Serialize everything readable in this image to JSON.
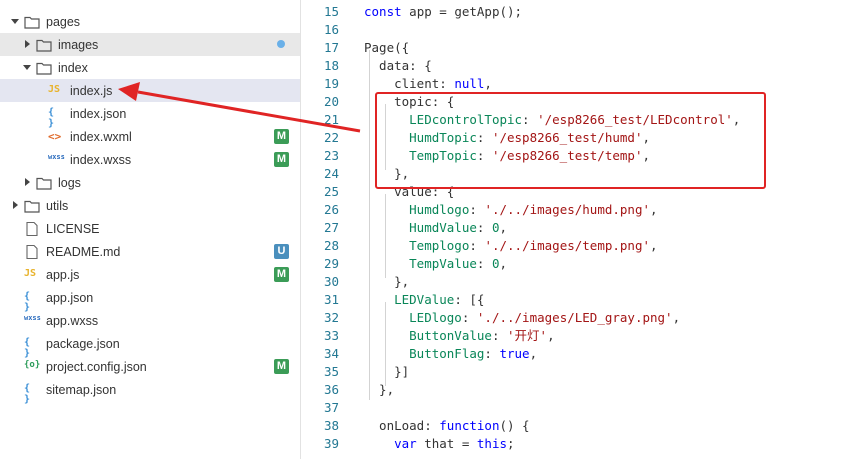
{
  "explorer": {
    "items": [
      {
        "label": "pages",
        "type": "folder",
        "expanded": true,
        "depth": 0
      },
      {
        "label": "images",
        "type": "folder",
        "expanded": false,
        "depth": 1,
        "dot": true
      },
      {
        "label": "index",
        "type": "folder",
        "expanded": true,
        "depth": 1
      },
      {
        "label": "index.js",
        "type": "js",
        "depth": 2,
        "selected": true
      },
      {
        "label": "index.json",
        "type": "json",
        "depth": 2
      },
      {
        "label": "index.wxml",
        "type": "wxml",
        "depth": 2,
        "badge": "M"
      },
      {
        "label": "index.wxss",
        "type": "wxss",
        "depth": 2,
        "badge": "M"
      },
      {
        "label": "logs",
        "type": "folder",
        "expanded": false,
        "depth": 1
      },
      {
        "label": "utils",
        "type": "folder",
        "expanded": false,
        "depth": 0
      },
      {
        "label": "LICENSE",
        "type": "file",
        "depth": 0
      },
      {
        "label": "README.md",
        "type": "file",
        "depth": 0,
        "badge": "U"
      },
      {
        "label": "app.js",
        "type": "js",
        "depth": 0,
        "badge": "M"
      },
      {
        "label": "app.json",
        "type": "json",
        "depth": 0
      },
      {
        "label": "app.wxss",
        "type": "wxss",
        "depth": 0
      },
      {
        "label": "package.json",
        "type": "json",
        "depth": 0
      },
      {
        "label": "project.config.json",
        "type": "config",
        "depth": 0,
        "badge": "M"
      },
      {
        "label": "sitemap.json",
        "type": "json",
        "depth": 0
      }
    ],
    "icon_text": {
      "js": "JS",
      "json": "{ }",
      "wxml": "<>",
      "wxss": "wxss",
      "config": "{o}"
    }
  },
  "editor": {
    "lines": [
      {
        "n": "15",
        "tokens": [
          [
            "kw",
            "const"
          ],
          [
            "t",
            " app = getApp();"
          ]
        ]
      },
      {
        "n": "16",
        "tokens": []
      },
      {
        "n": "17",
        "tokens": [
          [
            "t",
            "Page({"
          ]
        ]
      },
      {
        "n": "18",
        "tokens": [
          [
            "t",
            "  data: {"
          ]
        ]
      },
      {
        "n": "19",
        "tokens": [
          [
            "t",
            "    client: "
          ],
          [
            "kw",
            "null"
          ],
          [
            "t",
            ","
          ]
        ]
      },
      {
        "n": "20",
        "tokens": [
          [
            "t",
            "    topic: {"
          ]
        ]
      },
      {
        "n": "21",
        "tokens": [
          [
            "t",
            "      "
          ],
          [
            "prop",
            "LEDcontrolTopic"
          ],
          [
            "t",
            ": "
          ],
          [
            "str",
            "'/esp8266_test/LEDcontrol'"
          ],
          [
            "t",
            ","
          ]
        ]
      },
      {
        "n": "22",
        "tokens": [
          [
            "t",
            "      "
          ],
          [
            "prop",
            "HumdTopic"
          ],
          [
            "t",
            ": "
          ],
          [
            "str",
            "'/esp8266_test/humd'"
          ],
          [
            "t",
            ","
          ]
        ]
      },
      {
        "n": "23",
        "tokens": [
          [
            "t",
            "      "
          ],
          [
            "prop",
            "TempTopic"
          ],
          [
            "t",
            ": "
          ],
          [
            "str",
            "'/esp8266_test/temp'"
          ],
          [
            "t",
            ","
          ]
        ]
      },
      {
        "n": "24",
        "tokens": [
          [
            "t",
            "    },"
          ]
        ]
      },
      {
        "n": "25",
        "tokens": [
          [
            "t",
            "    value: {"
          ]
        ]
      },
      {
        "n": "26",
        "tokens": [
          [
            "t",
            "      "
          ],
          [
            "prop",
            "Humdlogo"
          ],
          [
            "t",
            ": "
          ],
          [
            "str",
            "'./../images/humd.png'"
          ],
          [
            "t",
            ","
          ]
        ]
      },
      {
        "n": "27",
        "tokens": [
          [
            "t",
            "      "
          ],
          [
            "prop",
            "HumdValue"
          ],
          [
            "t",
            ": "
          ],
          [
            "num",
            "0"
          ],
          [
            "t",
            ","
          ]
        ]
      },
      {
        "n": "28",
        "tokens": [
          [
            "t",
            "      "
          ],
          [
            "prop",
            "Templogo"
          ],
          [
            "t",
            ": "
          ],
          [
            "str",
            "'./../images/temp.png'"
          ],
          [
            "t",
            ","
          ]
        ]
      },
      {
        "n": "29",
        "tokens": [
          [
            "t",
            "      "
          ],
          [
            "prop",
            "TempValue"
          ],
          [
            "t",
            ": "
          ],
          [
            "num",
            "0"
          ],
          [
            "t",
            ","
          ]
        ]
      },
      {
        "n": "30",
        "tokens": [
          [
            "t",
            "    },"
          ]
        ]
      },
      {
        "n": "31",
        "tokens": [
          [
            "t",
            "    "
          ],
          [
            "prop",
            "LEDValue"
          ],
          [
            "t",
            ": [{"
          ]
        ]
      },
      {
        "n": "32",
        "tokens": [
          [
            "t",
            "      "
          ],
          [
            "prop",
            "LEDlogo"
          ],
          [
            "t",
            ": "
          ],
          [
            "str",
            "'./../images/LED_gray.png'"
          ],
          [
            "t",
            ","
          ]
        ]
      },
      {
        "n": "33",
        "tokens": [
          [
            "t",
            "      "
          ],
          [
            "prop",
            "ButtonValue"
          ],
          [
            "t",
            ": "
          ],
          [
            "str",
            "'开灯'"
          ],
          [
            "t",
            ","
          ]
        ]
      },
      {
        "n": "34",
        "tokens": [
          [
            "t",
            "      "
          ],
          [
            "prop",
            "ButtonFlag"
          ],
          [
            "t",
            ": "
          ],
          [
            "kw",
            "true"
          ],
          [
            "t",
            ","
          ]
        ]
      },
      {
        "n": "35",
        "tokens": [
          [
            "t",
            "    }]"
          ]
        ]
      },
      {
        "n": "36",
        "tokens": [
          [
            "t",
            "  },"
          ]
        ]
      },
      {
        "n": "37",
        "tokens": []
      },
      {
        "n": "38",
        "tokens": [
          [
            "t",
            "  onLoad: "
          ],
          [
            "kw",
            "function"
          ],
          [
            "t",
            "() {"
          ]
        ]
      },
      {
        "n": "39",
        "tokens": [
          [
            "t",
            "    "
          ],
          [
            "kw",
            "var"
          ],
          [
            "t",
            " that = "
          ],
          [
            "kw",
            "this"
          ],
          [
            "t",
            ";"
          ]
        ]
      }
    ]
  },
  "colors": {
    "highlight_box": "#e02424",
    "arrow": "#e02424",
    "badge_m": "#3b9c57",
    "badge_u": "#4a8fbd"
  }
}
